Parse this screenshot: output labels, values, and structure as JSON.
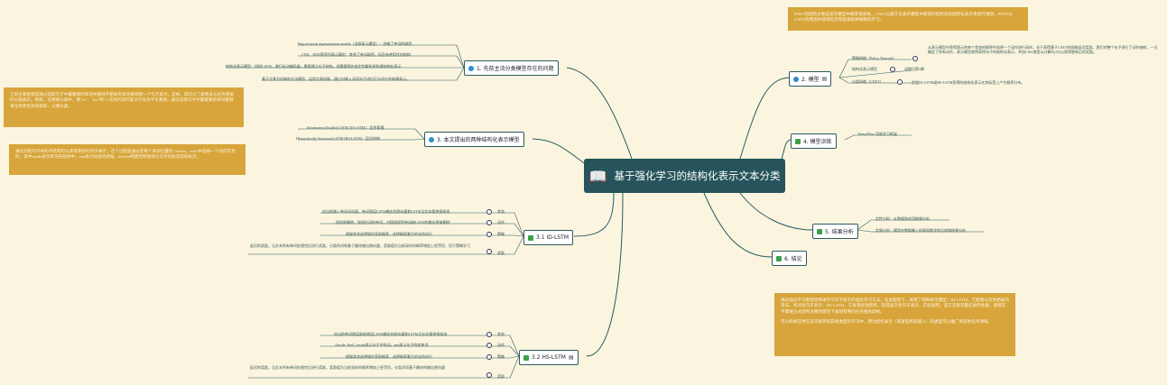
{
  "root": {
    "title": "基于强化学习的结构化表示文本分类",
    "icon": "book-icon"
  },
  "topics": {
    "t1": {
      "label": "1. 先前主流分类模型存在的问题",
      "icon": "info-icon"
    },
    "t2": {
      "label": "2. 模型",
      "icon": "info-icon"
    },
    "t3": {
      "label": "3. 本文提出的两种结构化表示模型",
      "icon": "info-icon"
    },
    "t4": {
      "label": "4. 模型训练",
      "icon": "check-icon"
    },
    "t31": {
      "label": "3.1 ID-LSTM",
      "icon": "check-icon"
    },
    "t5": {
      "label": "5. 结果分析",
      "icon": "check-icon"
    },
    "t6": {
      "label": "6. 结论",
      "icon": "check-icon"
    },
    "t32": {
      "label": "3.2 HS-LSTM",
      "icon": "check-icon"
    }
  },
  "t1_leaves": [
    "Bag-of-words representation models（词袋表示模型）：忽略了单词的顺序",
    "CNN、RNN等序列表示模型：考虑了单词顺序，但没有使用任何结构",
    "结构化表示模型：如树LSTM，递归自动编码器，需要建立句子结构，但需要预先给定的解析树构建结构化表示",
    "基于注意力机制的方法模型：运用注意机制，通过对输入词语句子进行打分评分并构建表示。"
  ],
  "t3_leaves": [
    "Information Distilled LSTM (ID-LSTM)：信息蒸馏",
    "Hierarchically Structured LSTM (HS-LSTM)：层次结构"
  ],
  "t3_notes": [
    "它的主要思想是通过选取句子中最重要的单词并删除不相关的单词来构建一个句子表示。这样，就可以了解更多与任务相关的分类表示。例如，在情感分类中，像\"to\"、\"the\"和\"a\"这样的词可能对于任务不太重要。通过选取句子中最重要的单词能够将任务更有效的获取，以便分类。",
    "通过识别句子中的子结构可以获得更好的句子表示，这个过程是通过在每个单词位置的 {inside，end}中选择一个动作实现的，其中inside表示单词在短语中，end表示短语的结尾。bi-lstm构建结构性地与句子的层次结构表示。"
  ],
  "t2_leaves": {
    "policy": "策略网络（Policy Network）",
    "policy_desc": "从表示模型中获得表示的每个状态的概率中选择一个动作进行采样。关于获得基于CNET的网络延迟奖励，我们对整个句子进行了动作抽样，一旦确定了所有动作，表示模型就将获得句子的结构化表示，并由CNet使用以计算P(y|X)以获得更新后的奖励。",
    "repr": "结构化表示模型",
    "repr_desc": "详细见第3章",
    "cnet": "分类网络（CNET）",
    "cnet_desc": "根据ID-LSTM或HS-LSTM获得的结构化表示在其标签上产生概率分布。"
  },
  "t2_note": "PNET的结构主要是表示模型中概率值采样，CNET以据于主表示模型中获得的结构化的结构化表示来进行预测，PNET从CNET的预测中获得延迟奖励来指导策略的学习。",
  "t4_leaves": [
    "TensorFlow 深度学习框架"
  ],
  "t5_leaves": [
    "定性分析：从数据和应用能够分析",
    "定量分析：模型在数据集上的表现数字的比较和结果分析"
  ],
  "t6_note": [
    "通过强化学习框架结构来学习句子表示的强化学习方法。在此框架下，采用了两种表示模型：ID-LSTM，它能够与任务相关的单词，和对短句子表示：HS-LSTM，它发现短语结构，形成层次化句子表示。实验表明，该方法具有最先进的性能，能够在不需要正式结构注释的情况下发现有用的任务相关结构。",
    "可以构想这种方法可能转到其他类型的学习中，用为结构表示（或某些构造输入）的进度可以推广到其他任务领域。"
  ],
  "t31_leaves": [
    {
      "text": "由当前输入单词词向量，单词隐层LSTM输出的隐向量和LSTM记忆向量拼接组成",
      "tag": "状态"
    },
    {
      "text": "保留和删除，保留在词的单词，对值保留到单词被LSTM的输出将被删除",
      "tag": "动作"
    },
    {
      "text": "根据状态选择操作获取概率，选择概率最大的动作执行",
      "tag": "策略"
    },
    {
      "text": "延迟的奖励，当文本所有单词处理完后进行奖励，分类的词和基于最终输出隐向量，奖励值为当前采样的概率增加上惩罚项，用于策略学习",
      "tag": "奖励"
    }
  ],
  "t32_leaves": [
    {
      "text": "由当前单词隐层前前隐层LSTM输出的隐向量和LSTM记忆向量拼接组成",
      "tag": "状态"
    },
    {
      "text": "{Inside, End}, inside表示句子中的词，end表示句子的结束词",
      "tag": "动作"
    },
    {
      "text": "根据状态选择操作获取概率，选择概率最大的动作执行",
      "tag": "策略"
    },
    {
      "text": "延迟的奖励，当文本所有单词处理完后进行奖励，奖励值为当前采样的概率增加上惩罚项，分类词项基于最终的输出隐向量",
      "tag": "奖励"
    }
  ],
  "colors": {
    "branch": "#2b5a62",
    "note": "#d7a53b",
    "root": "#27545c",
    "bg": "#fbf5df"
  }
}
